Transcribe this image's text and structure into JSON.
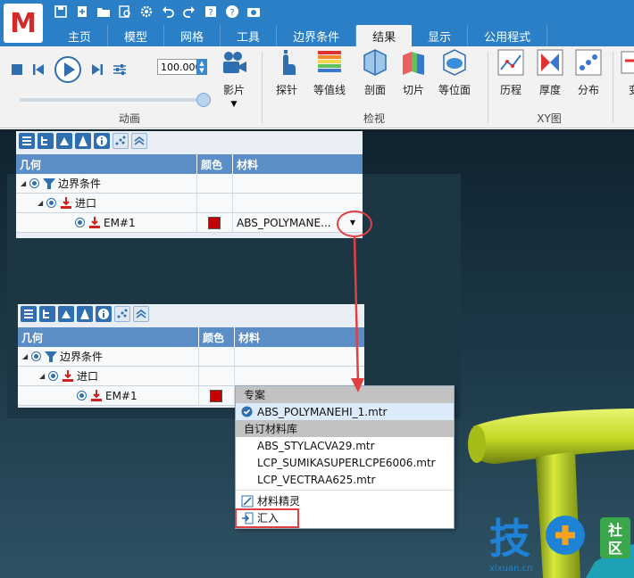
{
  "app": {
    "logo_letter": "M"
  },
  "quick_access": [
    "save-icon",
    "new-icon",
    "open-icon",
    "preview-icon",
    "gear-icon",
    "undo-icon",
    "redo-icon",
    "help-box-icon",
    "help-icon",
    "camera-icon"
  ],
  "tabs": [
    "主页",
    "模型",
    "网格",
    "工具",
    "边界条件",
    "结果",
    "显示",
    "公用程式"
  ],
  "active_tab": "结果",
  "ribbon": {
    "animation": {
      "value": "100.000",
      "movie_label": "影片",
      "group_label": "动画"
    },
    "inspect": {
      "tools": [
        "探针",
        "等值线",
        "剖面",
        "切片",
        "等位面"
      ],
      "group_label": "检视"
    },
    "xy": {
      "tools": [
        "历程",
        "厚度",
        "分布"
      ],
      "group_label": "XY图"
    },
    "cut_tool": "变"
  },
  "grid": {
    "headers": [
      "几何",
      "颜色",
      "材料"
    ],
    "rows": [
      {
        "label": "边界条件",
        "level": 0
      },
      {
        "label": "进口",
        "level": 1
      },
      {
        "label": "EM#1",
        "level": 2,
        "color": "#c40000",
        "material": "ABS_POLYMANE..."
      }
    ]
  },
  "dropdown": {
    "section_project": "专案",
    "project_items": [
      "ABS_POLYMANEHI_1.mtr"
    ],
    "section_custom": "自订材料库",
    "custom_items": [
      "ABS_STYLACVA29.mtr",
      "LCP_SUMIKASUPERLCPE6006.mtr",
      "LCP_VECTRAA625.mtr"
    ],
    "action_wizard": "材料精灵",
    "action_import": "汇入"
  },
  "watermark": {
    "main": "技",
    "badge_top": "社",
    "badge_bottom": "区",
    "url": "xixuan.cn"
  },
  "colors": {
    "accent": "#2a7fc6",
    "annotation": "#e04040",
    "swatch": "#c40000"
  }
}
